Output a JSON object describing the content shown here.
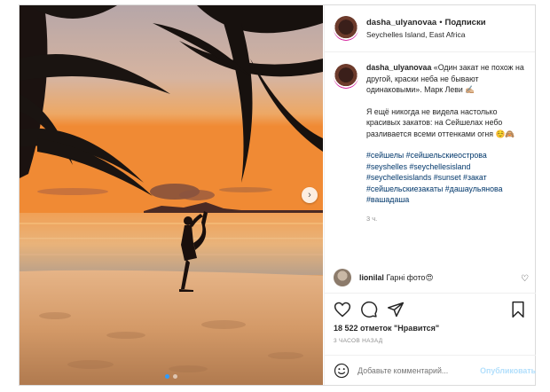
{
  "post": {
    "username": "dasha_ulyanovaa",
    "separator": "•",
    "follow_label": "Подписки",
    "location": "Seychelles Island, East Africa"
  },
  "caption": {
    "username": "dasha_ulyanovaa",
    "text1": "«Один закат не похож на другой, краски неба не бывают одинаковыми». Марк Леви ✍🏼",
    "text2": "Я ещё никогда не видела настолько красивых закатов: на Сейшелах небо разливается всеми оттенками огня ☺️🙈",
    "hashtags": "#сейшелы #сейшельскиеострова #seyshelles #seychellesisland #seychellesislands #sunset #закат #сейшельскиезакаты #дашаульянова #вашадаша",
    "time": "3 ч."
  },
  "comment": {
    "username": "lionilal",
    "text": "Гарні фото😍"
  },
  "stats": {
    "likes": "18 522 отметок \"Нравится\"",
    "posted": "3 ЧАСОВ НАЗАД"
  },
  "add_comment": {
    "placeholder": "Добавьте комментарий...",
    "publish_label": "Опубликовать"
  },
  "icons": {
    "next": "chevron-right-icon",
    "like": "heart-icon",
    "comment": "comment-icon",
    "share": "share-icon",
    "save": "bookmark-icon",
    "emoji": "smile-icon"
  },
  "carousel": {
    "total": 2,
    "active": 1
  }
}
